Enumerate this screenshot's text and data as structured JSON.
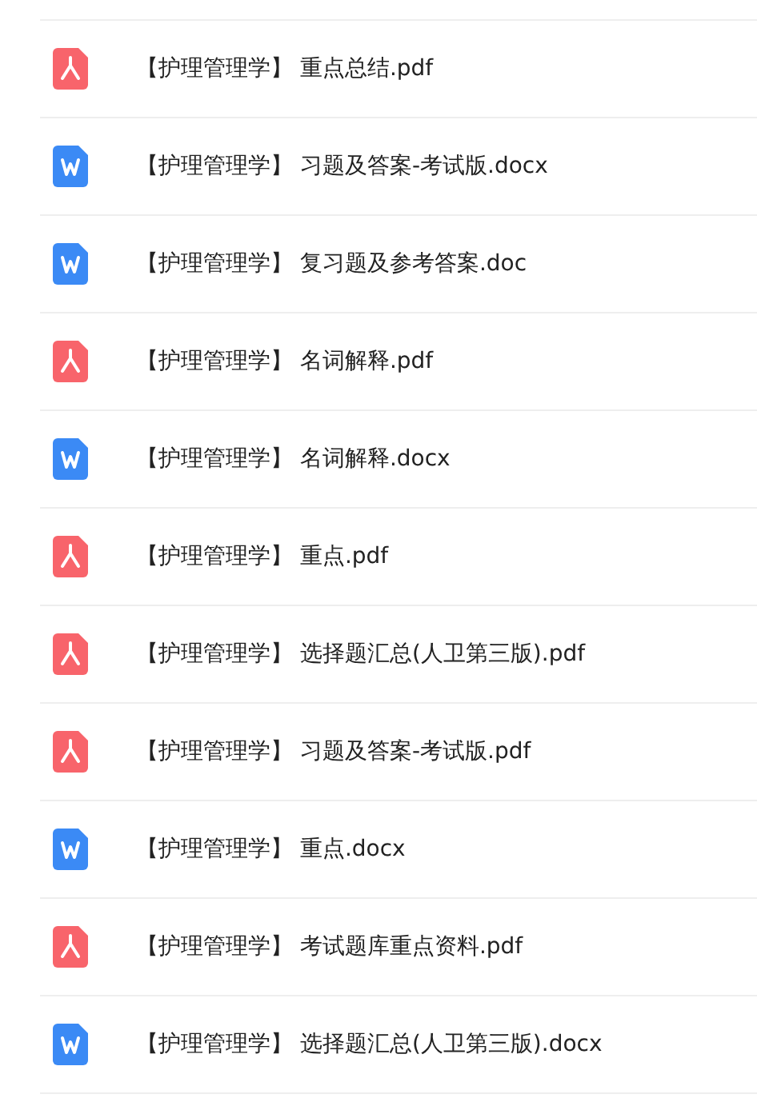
{
  "files": [
    {
      "kind": "pdf",
      "name": "【护理管理学】 重点总结.pdf"
    },
    {
      "kind": "word",
      "name": "【护理管理学】 习题及答案-考试版.docx"
    },
    {
      "kind": "word",
      "name": "【护理管理学】 复习题及参考答案.doc"
    },
    {
      "kind": "pdf",
      "name": "【护理管理学】 名词解释.pdf"
    },
    {
      "kind": "word",
      "name": "【护理管理学】 名词解释.docx"
    },
    {
      "kind": "pdf",
      "name": "【护理管理学】 重点.pdf"
    },
    {
      "kind": "pdf",
      "name": "【护理管理学】 选择题汇总(人卫第三版).pdf"
    },
    {
      "kind": "pdf",
      "name": "【护理管理学】 习题及答案-考试版.pdf"
    },
    {
      "kind": "word",
      "name": "【护理管理学】 重点.docx"
    },
    {
      "kind": "pdf",
      "name": "【护理管理学】 考试题库重点资料.pdf"
    },
    {
      "kind": "word",
      "name": "【护理管理学】 选择题汇总(人卫第三版).docx"
    }
  ]
}
